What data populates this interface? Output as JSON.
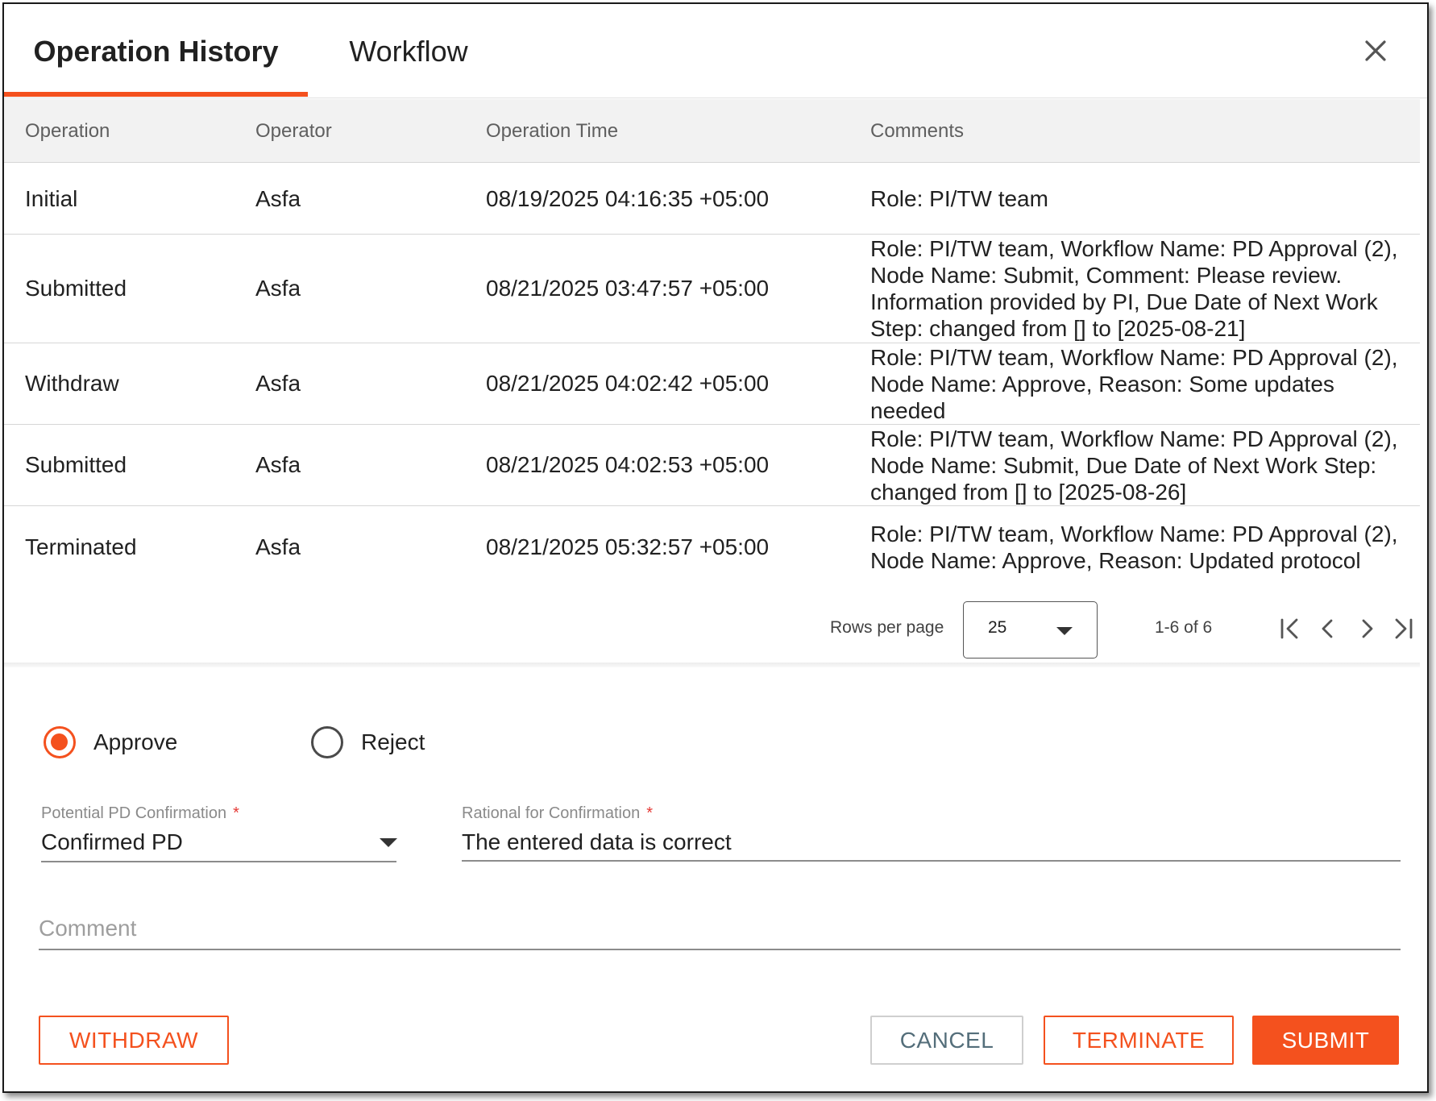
{
  "tabs": [
    {
      "label": "Operation History",
      "active": true
    },
    {
      "label": "Workflow",
      "active": false
    }
  ],
  "close_icon": "close-icon",
  "accent_color": "#f4511e",
  "table": {
    "headers": [
      "Operation",
      "Operator",
      "Operation Time",
      "Comments"
    ],
    "rows": [
      {
        "operation": "Initial",
        "operator": "Asfa",
        "time": "08/19/2025 04:16:35 +05:00",
        "comments": "Role: PI/TW team"
      },
      {
        "operation": "Submitted",
        "operator": "Asfa",
        "time": "08/21/2025 03:47:57 +05:00",
        "comments": "Role: PI/TW team, Workflow Name: PD Approval (2), Node Name: Submit, Comment: Please review. Information provided by PI, Due Date of Next Work Step: changed from [] to [2025-08-21]"
      },
      {
        "operation": "Withdraw",
        "operator": "Asfa",
        "time": "08/21/2025 04:02:42 +05:00",
        "comments": "Role: PI/TW team, Workflow Name: PD Approval (2), Node Name: Approve, Reason: Some updates needed"
      },
      {
        "operation": "Submitted",
        "operator": "Asfa",
        "time": "08/21/2025 04:02:53 +05:00",
        "comments": "Role: PI/TW team, Workflow Name: PD Approval (2), Node Name: Submit, Due Date of Next Work Step: changed from [] to [2025-08-26]"
      },
      {
        "operation": "Terminated",
        "operator": "Asfa",
        "time": "08/21/2025 05:32:57 +05:00",
        "comments": "Role: PI/TW team, Workflow Name: PD Approval (2), Node Name: Approve, Reason: Updated protocol"
      }
    ]
  },
  "pagination": {
    "rows_per_page_label": "Rows per page",
    "rows_per_page_value": "25",
    "range_text": "1-6 of 6",
    "icons": [
      "first-page-icon",
      "previous-page-icon",
      "next-page-icon",
      "last-page-icon"
    ]
  },
  "form": {
    "decision": {
      "options": [
        {
          "label": "Approve",
          "checked": true
        },
        {
          "label": "Reject",
          "checked": false
        }
      ]
    },
    "pd_confirmation": {
      "label": "Potential PD Confirmation",
      "required_mark": "*",
      "value": "Confirmed PD"
    },
    "rationale": {
      "label": "Rational for Confirmation",
      "required_mark": "*",
      "value": "The entered data is correct"
    },
    "comment": {
      "placeholder": "Comment",
      "value": ""
    }
  },
  "buttons": {
    "withdraw": "WITHDRAW",
    "cancel": "CANCEL",
    "terminate": "TERMINATE",
    "submit": "SUBMIT"
  }
}
